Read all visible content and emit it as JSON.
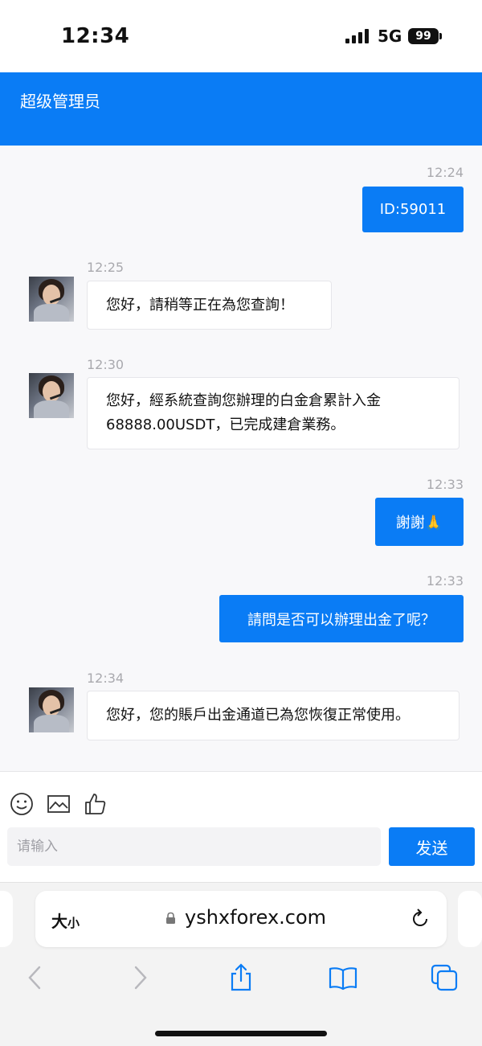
{
  "status_bar": {
    "time": "12:34",
    "network": "5G",
    "battery": "99"
  },
  "header": {
    "title": "超级管理员"
  },
  "messages": [
    {
      "time": "12:24",
      "text": "ID:59011"
    },
    {
      "time": "12:25",
      "text": "您好，請稍等正在為您查詢！"
    },
    {
      "time": "12:30",
      "line1": "您好，經系統查詢您辦理的白金倉累計入金",
      "line2": "68888.00USDT，已完成建倉業務。"
    },
    {
      "time": "12:33",
      "text": "謝謝🙏"
    },
    {
      "time": "12:33",
      "text": "請問是否可以辦理出金了呢？"
    },
    {
      "time": "12:34",
      "text": "您好，您的賬戶出金通道已為您恢復正常使用。"
    }
  ],
  "input": {
    "placeholder": "请输入",
    "send_label": "发送"
  },
  "browser": {
    "text_size_big": "大",
    "text_size_small": "小",
    "url": "yshxforex.com"
  },
  "icons": {
    "emoji": "emoji-icon",
    "image": "image-icon",
    "like": "thumbs-up-icon",
    "lock": "lock-icon",
    "reload": "reload-icon",
    "back": "chevron-left-icon",
    "forward": "chevron-right-icon",
    "share": "share-icon",
    "bookmarks": "book-icon",
    "tabs": "tabs-icon"
  },
  "colors": {
    "accent": "#0a7cf5",
    "background": "#f8f8fa"
  }
}
